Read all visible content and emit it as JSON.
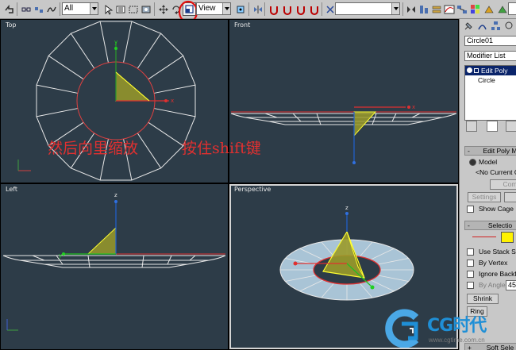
{
  "toolbar": {
    "filter_select": "All",
    "coord_select": "View",
    "named_selection": "",
    "icons": [
      "undo-icon",
      "redo-icon",
      "link-icon",
      "unlink-icon",
      "bind-space-warp-icon",
      "select-filter",
      "select-object-icon",
      "select-by-name-icon",
      "rect-region-icon",
      "window-crossing-icon",
      "move-icon",
      "rotate-icon",
      "scale-icon",
      "reference-coord",
      "pivot-center-icon",
      "mirror-icon",
      "align-icon",
      "snap-icon",
      "angle-snap-icon",
      "percent-snap-icon",
      "spinner-snap-icon",
      "named-sets",
      "curve-editor-icon",
      "schematic-icon",
      "material-editor-icon",
      "render-setup-icon",
      "quick-render-icon"
    ],
    "highlight": "red-circle-around-scale-tool"
  },
  "viewports": {
    "top": {
      "label": "Top"
    },
    "front": {
      "label": "Front"
    },
    "left": {
      "label": "Left"
    },
    "perspective": {
      "label": "Perspective"
    }
  },
  "annotations": {
    "scale_inward": "然后向里缩放",
    "hold_shift": "按住shift键"
  },
  "axis_labels": {
    "x": "x",
    "y": "y",
    "z": "z"
  },
  "command_panel": {
    "object_name": "Circle01",
    "modifier_list": "Modifier List",
    "stack": [
      {
        "label": "Edit Poly",
        "selected": true
      },
      {
        "label": "Circle",
        "selected": false
      }
    ],
    "edit_poly_rollout": "Edit Poly M",
    "model_radio": "Model",
    "no_current": "<No Current O",
    "commit_button": "Commi",
    "settings_button": "Settings",
    "show_cage": "Show Cage",
    "selection_rollout": "Selectio",
    "use_stack": "Use Stack Sel",
    "by_vertex": "By Vertex",
    "ignore_backfacing": "Ignore Backfa",
    "by_angle": "By Angle:",
    "by_angle_value": "45",
    "shrink_button": "Shrink",
    "ring_button": "Ring",
    "soft_selection": "Soft Sele"
  },
  "watermark": {
    "brand": "CG时代",
    "url": "www.cgtime.com.cn"
  },
  "colors": {
    "viewport_bg": "#2d3c48",
    "wire": "#e8e8e8",
    "selected_edge": "#e03030",
    "gizmo_yellow": "#ffff30",
    "gizmo_fill": "#a3a32c",
    "annotation": "#e03030",
    "highlight_circle": "#e01010"
  }
}
